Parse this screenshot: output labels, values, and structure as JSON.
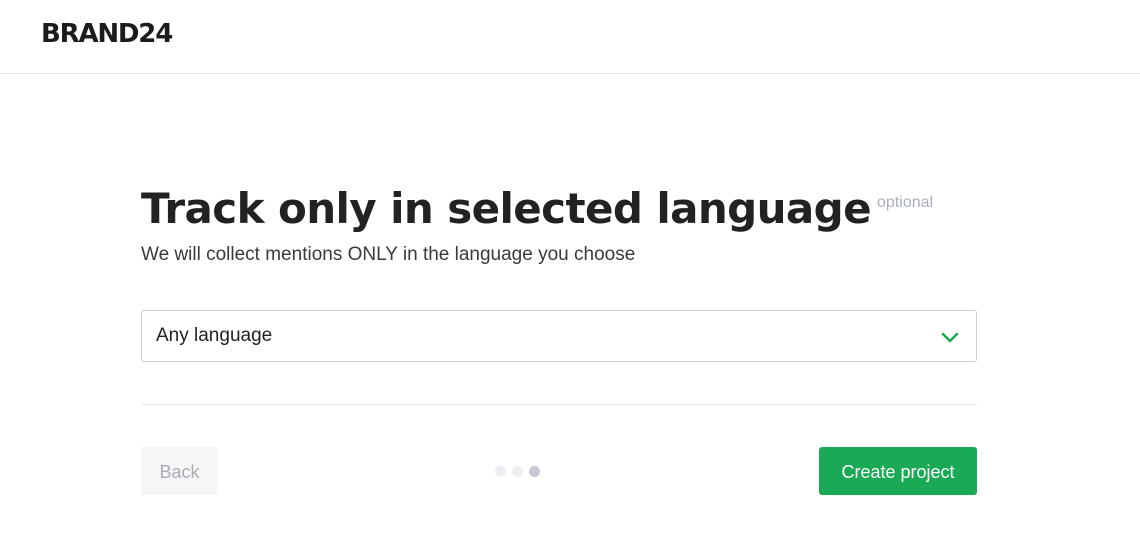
{
  "header": {
    "logo_text": "BRAND24"
  },
  "step": {
    "title": "Track only in selected language",
    "optional_label": "optional",
    "subtitle": "We will collect mentions ONLY in the language you choose"
  },
  "language_select": {
    "value": "Any language",
    "icon": "chevron-down-icon"
  },
  "footer": {
    "back_label": "Back",
    "create_label": "Create project",
    "progress": {
      "total_steps": 3,
      "current_step": 3
    }
  },
  "colors": {
    "accent_green": "#1aaa55",
    "chevron_green": "#1aaa55",
    "optional_gray": "#a8afba",
    "dot_inactive": "#eceef1",
    "dot_active": "#c4c8d2"
  }
}
